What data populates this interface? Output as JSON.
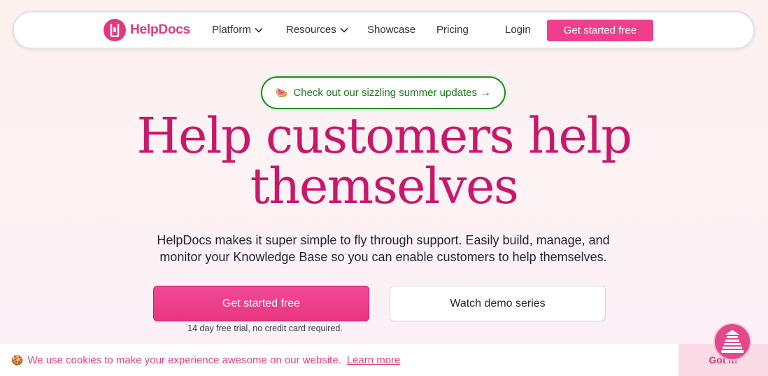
{
  "brand": {
    "name": "HelpDocs",
    "color": "#e3397f"
  },
  "nav": {
    "items": [
      {
        "label": "Platform",
        "has_dropdown": true
      },
      {
        "label": "Resources",
        "has_dropdown": true
      },
      {
        "label": "Showcase",
        "has_dropdown": false
      },
      {
        "label": "Pricing",
        "has_dropdown": false
      }
    ],
    "login": "Login",
    "cta": "Get started free"
  },
  "announcement": {
    "emoji": "🍉",
    "text": "Check out our sizzling summer updates",
    "arrow": "→"
  },
  "hero": {
    "headline_line1": "Help customers help",
    "headline_line2": "themselves",
    "subtitle": "HelpDocs makes it super simple to fly through support. Easily build, manage, and monitor your Knowledge Base so you can enable customers to help themselves.",
    "primary_cta": "Get started free",
    "secondary_cta": "Watch demo series",
    "trial_note": "14 day free trial, no credit card required."
  },
  "cookie_banner": {
    "icon": "🍪",
    "text": "We use cookies to make your experience awesome on our website.",
    "link": "Learn more",
    "button": "Got it!"
  },
  "help_widget": {
    "icon": "helpdesk-lighthouse-icon"
  },
  "colors": {
    "accent": "#ef3f8c",
    "headline": "#c8186a",
    "announcement": "#1a7a1a"
  }
}
